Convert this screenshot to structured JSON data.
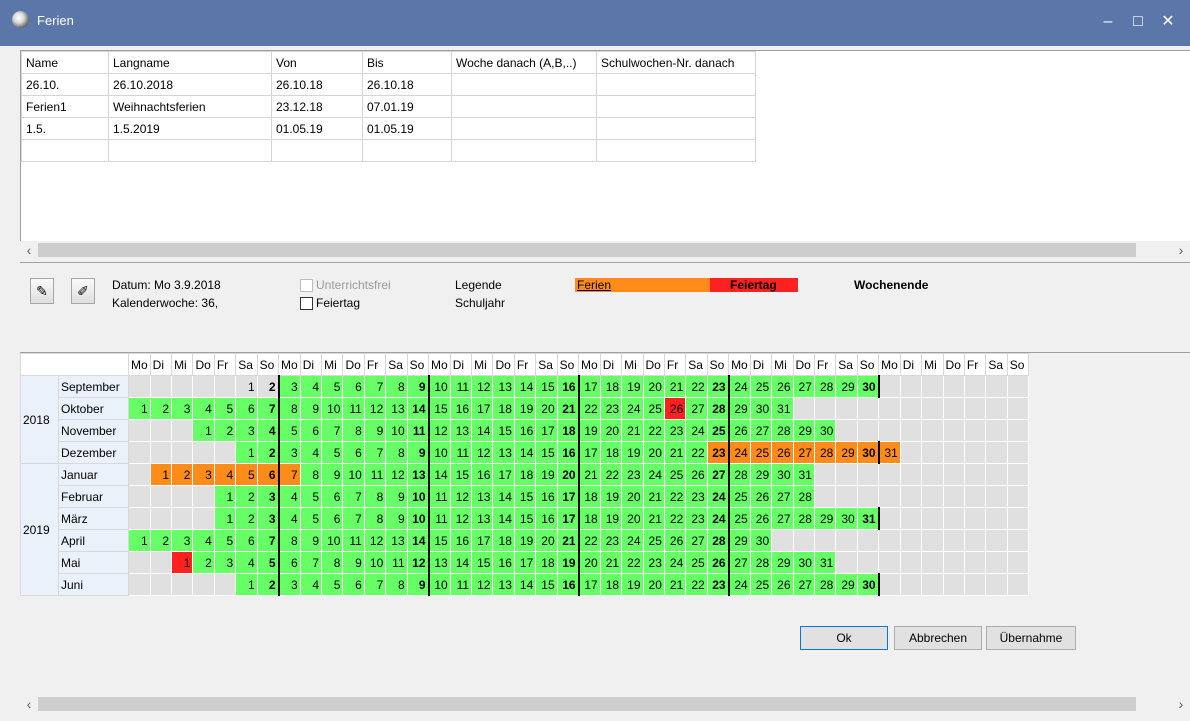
{
  "window": {
    "title": "Ferien",
    "min": "–",
    "max": "□",
    "close": "✕"
  },
  "holidays_table": {
    "columns": [
      "Name",
      "Langname",
      "Von",
      "Bis",
      "Woche danach (A,B,..)",
      "Schulwochen-Nr. danach"
    ],
    "rows": [
      [
        "26.10.",
        "26.10.2018",
        "26.10.18",
        "26.10.18",
        "",
        ""
      ],
      [
        "Ferien1",
        "Weihnachtsferien",
        "23.12.18",
        "07.01.19",
        "",
        ""
      ],
      [
        "1.5.",
        "1.5.2019",
        "01.05.19",
        "01.05.19",
        "",
        ""
      ],
      [
        "",
        "",
        "",
        "",
        "",
        ""
      ]
    ]
  },
  "info": {
    "datum": "Datum: Mo 3.9.2018",
    "kalenderwoche": "Kalenderwoche: 36,",
    "unterrichtsfrei": "Unterrichtsfrei",
    "feiertag": "Feiertag",
    "legende": "Legende",
    "schuljahr": "Schuljahr",
    "legend_ferien": "Ferien",
    "legend_feiertag": "Feiertag",
    "legend_wochenende": "Wochenende"
  },
  "colors": {
    "ferien": "#ff8c1a",
    "feiertag": "#ff2020",
    "schuljahr": "#66ff66",
    "outside": "#e0e0e0"
  },
  "calendar": {
    "weekdays": [
      "Mo",
      "Di",
      "Mi",
      "Do",
      "Fr",
      "Sa",
      "So",
      "Mo",
      "Di",
      "Mi",
      "Do",
      "Fr",
      "Sa",
      "So",
      "Mo",
      "Di",
      "Mi",
      "Do",
      "Fr",
      "Sa",
      "So",
      "Mo",
      "Di",
      "Mi",
      "Do",
      "Fr",
      "Sa",
      "So",
      "Mo",
      "Di",
      "Mi",
      "Do",
      "Fr",
      "Sa",
      "So",
      "Mo",
      "Di",
      "Mi",
      "Do",
      "Fr",
      "Sa",
      "So"
    ],
    "years": [
      {
        "label": "2018",
        "months": [
          {
            "name": "September",
            "first": 5,
            "days": 30,
            "status": {}
          },
          {
            "name": "Oktober",
            "first": 0,
            "days": 31,
            "status": {
              "26": "feiertag"
            }
          },
          {
            "name": "November",
            "first": 3,
            "days": 30,
            "status": {}
          },
          {
            "name": "Dezember",
            "first": 5,
            "days": 31,
            "status": {
              "23": "ferien",
              "24": "ferien",
              "25": "ferien",
              "26": "ferien",
              "27": "ferien",
              "28": "ferien",
              "29": "ferien",
              "30": "ferien",
              "31": "ferien"
            }
          }
        ]
      },
      {
        "label": "2019",
        "months": [
          {
            "name": "Januar",
            "first": 1,
            "days": 31,
            "status": {
              "1": "ferien",
              "2": "ferien",
              "3": "ferien",
              "4": "ferien",
              "5": "ferien",
              "6": "ferien",
              "7": "ferien"
            }
          },
          {
            "name": "Februar",
            "first": 4,
            "days": 28,
            "status": {}
          },
          {
            "name": "März",
            "first": 4,
            "days": 31,
            "status": {}
          },
          {
            "name": "April",
            "first": 0,
            "days": 30,
            "status": {}
          },
          {
            "name": "Mai",
            "first": 2,
            "days": 31,
            "status": {
              "1": "feiertag"
            }
          },
          {
            "name": "Juni",
            "first": 5,
            "days": 30,
            "status": {}
          }
        ]
      }
    ],
    "school_start": "2018-09-03",
    "school_end": "2019-06-30"
  },
  "buttons": {
    "ok": "Ok",
    "cancel": "Abbrechen",
    "apply": "Übernahme"
  }
}
